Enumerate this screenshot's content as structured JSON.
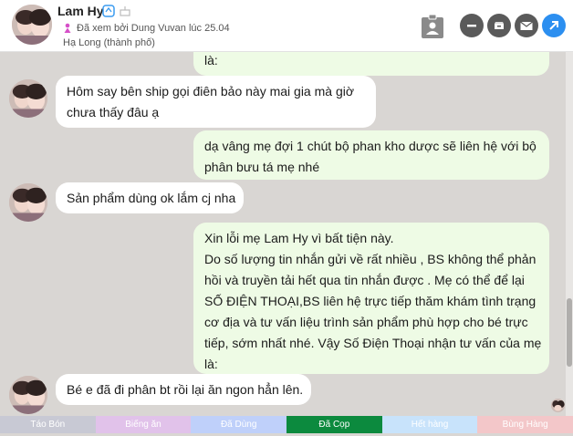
{
  "header": {
    "name": "Lam Hy",
    "seen": "Đã xem bởi Dung Vuvan lúc 25.04",
    "location": "Hạ Long (thành phố)"
  },
  "messages": [
    {
      "side": "out",
      "lines": [
        "là:"
      ]
    },
    {
      "side": "in",
      "lines": [
        "Hôm say bên ship gọi điên bảo này mai gia mà giờ",
        "chưa thấy đâu ạ"
      ]
    },
    {
      "side": "out",
      "lines": [
        "dạ vâng mẹ đợi 1 chút bộ phan kho dược sẽ liên hệ với bộ",
        "phân bưu tá mẹ nhé"
      ]
    },
    {
      "side": "in",
      "lines": [
        "Sản phẩm dùng ok lắm cj nha"
      ]
    },
    {
      "side": "out",
      "lines": [
        "Xin lỗi mẹ Lam Hy vì bất tiện này.",
        "Do số lượng tin nhắn gửi về rất nhiều , BS không thể phản",
        "hồi và truyền tải hết qua tin nhắn được . Mẹ có thể để lại",
        "SỐ ĐIỆN THOẠI,BS liên hệ trực tiếp thăm khám tình trạng",
        "cơ địa và tư vấn liệu trình sản phẩm phù hợp cho bé trực",
        "tiếp, sớm nhất nhé. Vậy Số Điện Thoại nhận tư vấn của mẹ",
        "là:"
      ]
    },
    {
      "side": "in",
      "lines": [
        "Bé e đã đi phân bt rồi lại ăn ngon hẳn lên."
      ]
    }
  ],
  "tags": [
    {
      "label": "Táo Bón",
      "color": "#c8c9d4"
    },
    {
      "label": "Biếng ăn",
      "color": "#e1c2ea"
    },
    {
      "label": "Đã Dùng",
      "color": "#bfd0fa"
    },
    {
      "label": "Đã Cọp",
      "color": "#0c8a3e"
    },
    {
      "label": "Hết hàng",
      "color": "#c8e3fb"
    },
    {
      "label": "Bùng Hàng",
      "color": "#f3c7c9"
    }
  ],
  "icons": {
    "verified": "verified-badge-icon",
    "gift": "birthday-cake-icon",
    "gender": "female-icon",
    "contact_card": "contact-card-icon",
    "minus": "minus-icon",
    "inbox": "inbox-icon",
    "mail": "mail-icon",
    "forward": "forward-arrow-icon"
  },
  "colors": {
    "chat_background": "#d9d6d3",
    "incoming_bubble": "#ffffff",
    "outgoing_bubble": "#eefbe5",
    "accent_blue": "#2c8ff0"
  }
}
